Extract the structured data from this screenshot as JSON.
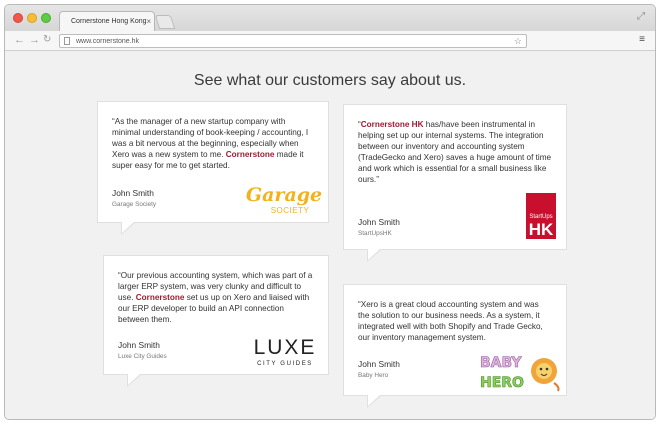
{
  "browser": {
    "tab_title": "Cornerstone Hong Kong",
    "tab_close": "×",
    "url": "www.cornerstone.hk",
    "back": "←",
    "forward": "→",
    "reload": "↻",
    "star": "☆",
    "menu": "≡",
    "resize": "⤢"
  },
  "page": {
    "heading": "See what our customers say about us."
  },
  "testimonials": [
    {
      "quote_before": "“As the manager of a new startup company with minimal understanding of book-keeping / accounting, I was a bit nervous at the beginning, especially when Xero was a new system to me. ",
      "brand": "Cornerstone",
      "quote_after": " made it super easy for me to get started.",
      "name": "John Smith",
      "company": "Garage Society",
      "logo_icon": "garage-society-logo",
      "logo_line1": "Garage",
      "logo_line2": "SOCIETY"
    },
    {
      "quote_before": "“",
      "brand": "Cornerstone HK",
      "quote_after": " has/have been instrumental in helping set up our internal systems. The integration between our inventory and accounting system (TradeGecko and Xero) saves a huge amount of time and work which is essential for a small business like ours.”",
      "name": "John Smith",
      "company": "StartUpsHK",
      "logo_icon": "startupshk-logo",
      "logo_line1": "StartUps",
      "logo_line2": "HK"
    },
    {
      "quote_before": "“Our previous accounting system, which was part of a larger ERP system, was very clunky and difficult to use. ",
      "brand": "Cornerstone",
      "quote_after": " set us up on Xero and liaised with our ERP developer to build an API connection between them.",
      "name": "John Smith",
      "company": "Luxe City Guides",
      "logo_icon": "luxe-city-guides-logo",
      "logo_line1": "LUXE",
      "logo_line2": "CITY GUIDES"
    },
    {
      "quote_before": "“Xero is a great cloud accounting system and was the solution to our business needs. As a system, it integrated well with both Shopify and Trade Gecko, our inventory management system.",
      "brand": "",
      "quote_after": "",
      "name": "John Smith",
      "company": "Baby Hero",
      "logo_icon": "baby-hero-logo",
      "logo_line1": "BABY",
      "logo_line2": "HERO"
    }
  ],
  "colors": {
    "brand": "#a01a32",
    "garage_yellow": "#f2b21c",
    "startups_red": "#c8102e"
  }
}
